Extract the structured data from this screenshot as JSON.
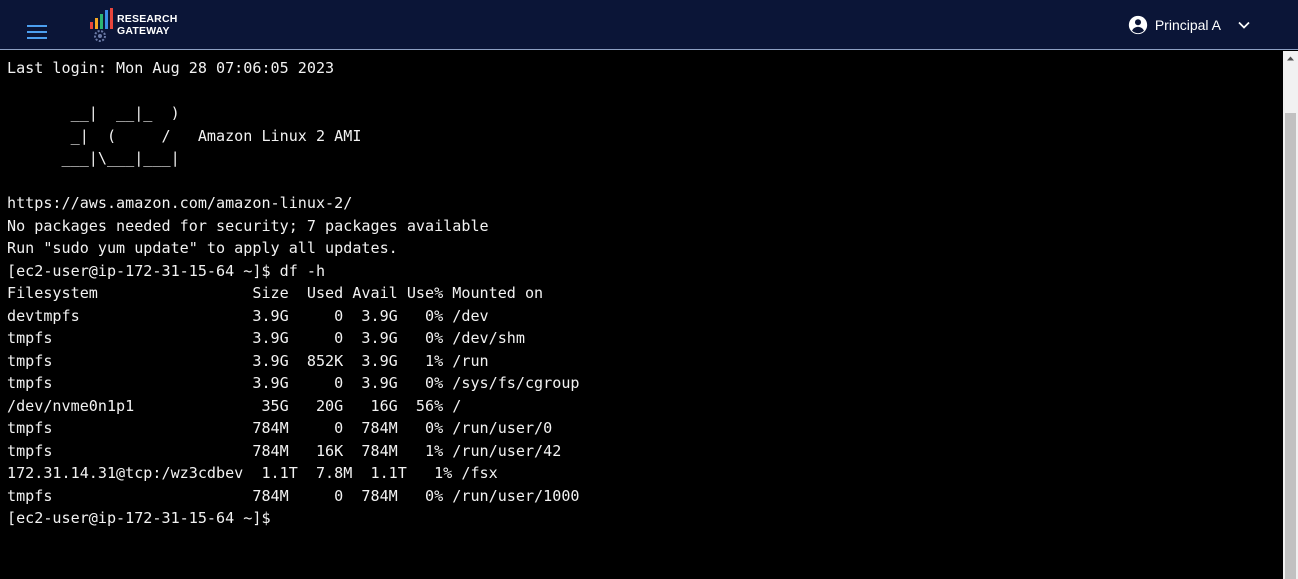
{
  "header": {
    "logo_line1": "RESEARCH",
    "logo_line2": "GATEWAY",
    "user_name": "Principal A",
    "icons": {
      "menu": "hamburger-menu-icon",
      "user": "account-circle-icon",
      "dropdown": "chevron-down-icon"
    },
    "colors": {
      "background": "#0b1537",
      "menu_icon": "#4c9ff0",
      "text": "#ffffff"
    }
  },
  "terminal": {
    "colors": {
      "background": "#000000",
      "text": "#f2f2f2"
    },
    "lines": [
      "Last login: Mon Aug 28 07:06:05 2023",
      "",
      "       __|  __|_  )",
      "       _|  (     /   Amazon Linux 2 AMI",
      "      ___|\\___|___|",
      "",
      "https://aws.amazon.com/amazon-linux-2/",
      "No packages needed for security; 7 packages available",
      "Run \"sudo yum update\" to apply all updates.",
      "[ec2-user@ip-172-31-15-64 ~]$ df -h",
      "Filesystem                 Size  Used Avail Use% Mounted on",
      "devtmpfs                   3.9G     0  3.9G   0% /dev",
      "tmpfs                      3.9G     0  3.9G   0% /dev/shm",
      "tmpfs                      3.9G  852K  3.9G   1% /run",
      "tmpfs                      3.9G     0  3.9G   0% /sys/fs/cgroup",
      "/dev/nvme0n1p1              35G   20G   16G  56% /",
      "tmpfs                      784M     0  784M   0% /run/user/0",
      "tmpfs                      784M   16K  784M   1% /run/user/42",
      "172.31.14.31@tcp:/wz3cdbev  1.1T  7.8M  1.1T   1% /fsx",
      "tmpfs                      784M     0  784M   0% /run/user/1000",
      "[ec2-user@ip-172-31-15-64 ~]$"
    ]
  }
}
